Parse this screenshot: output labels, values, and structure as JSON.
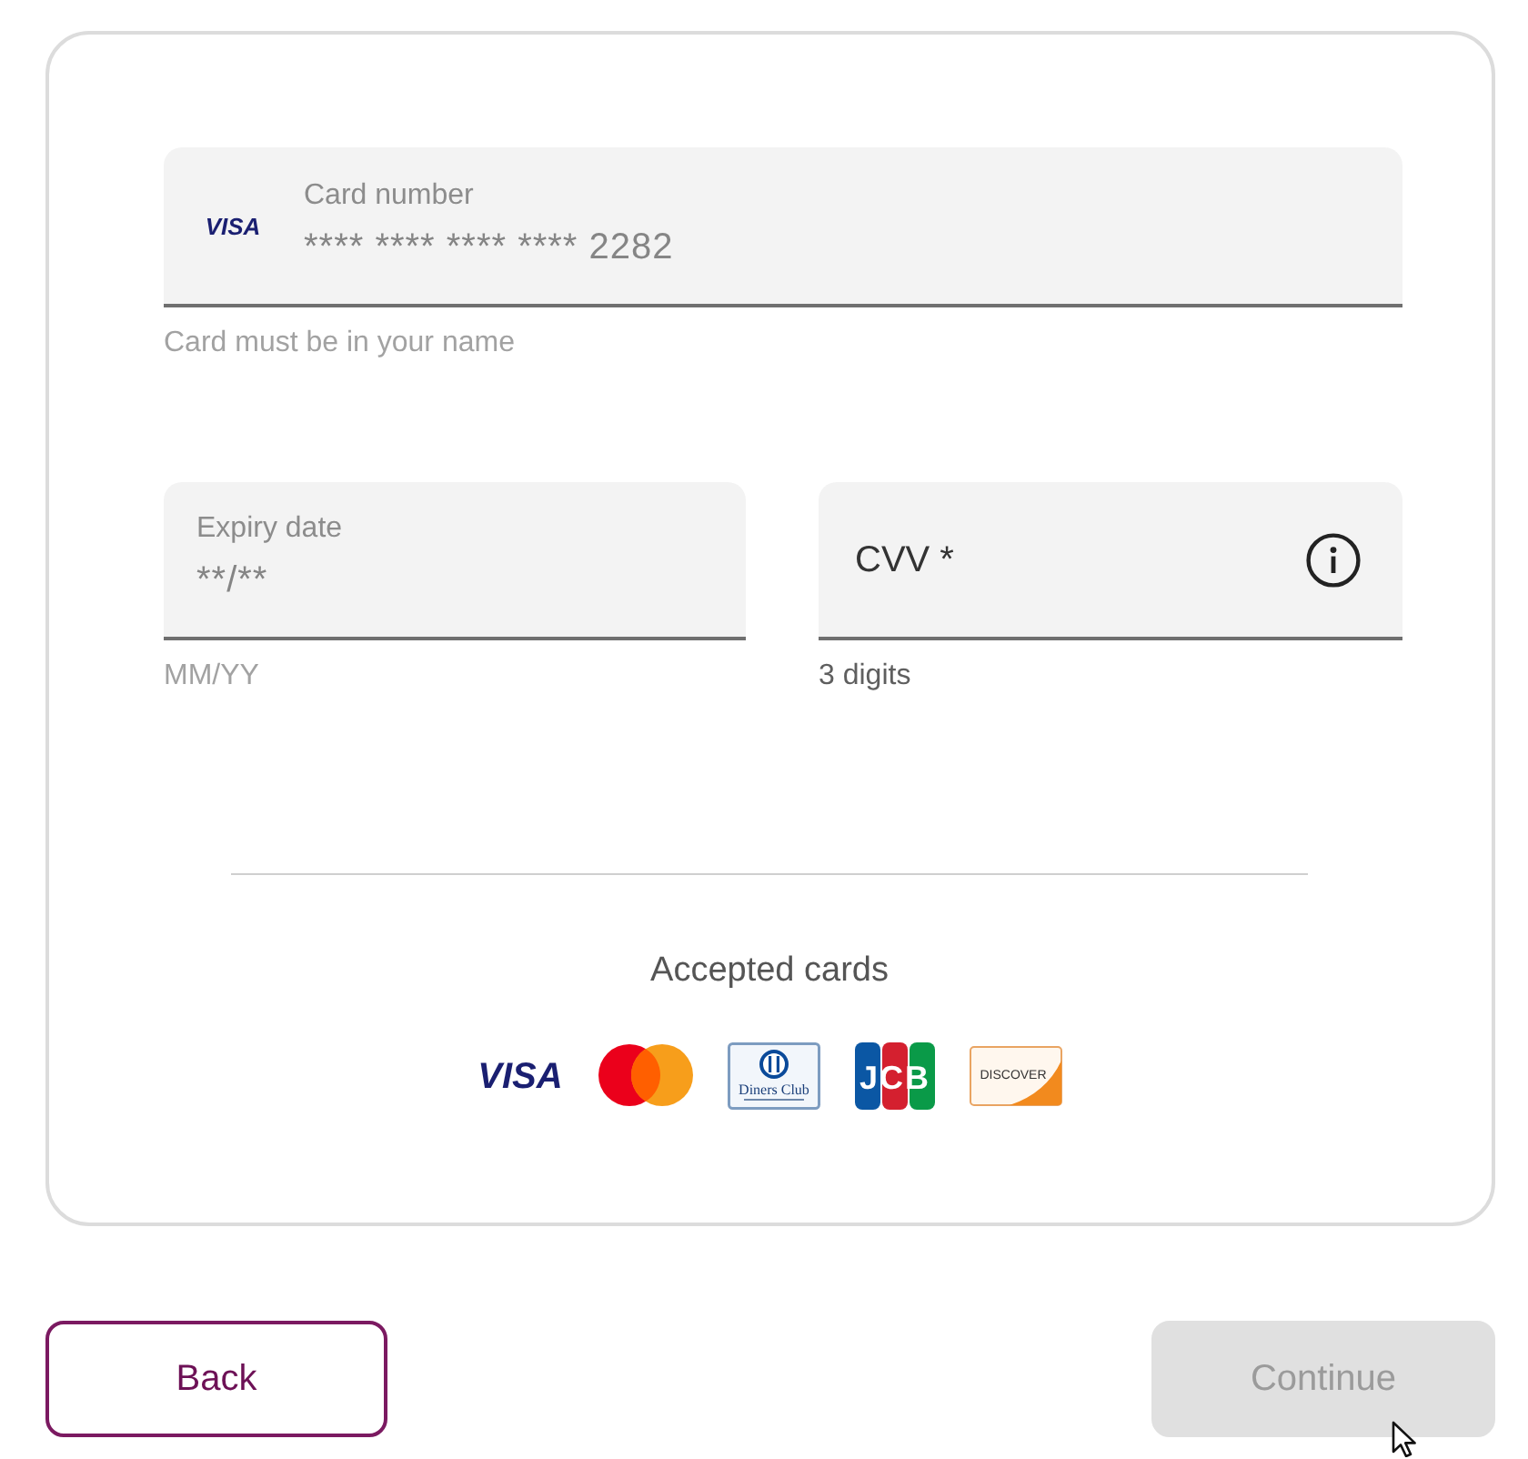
{
  "card_number": {
    "brand": "VISA",
    "label": "Card number",
    "value": "**** **** **** **** 2282",
    "helper": "Card must be in your name",
    "info_button": false
  },
  "date_and_code": [
    {
      "label": "Expiry date",
      "value": "**/**",
      "helper": "MM/YY",
      "info_button": false
    },
    {
      "label": "CVV *",
      "helper": "3 digits",
      "info_button": true
    }
  ],
  "accepted_cards": {
    "title": "Accepted cards",
    "logos": [
      {
        "kind": "visa",
        "text": "VISA"
      },
      {
        "kind": "mastercard"
      },
      {
        "kind": "diners",
        "text": "Diners Club"
      },
      {
        "kind": "jcb",
        "text": "JCB"
      },
      {
        "kind": "discover",
        "text": "DISCOVER"
      }
    ]
  },
  "buttons": [
    {
      "label": "Back",
      "kind": "secondary",
      "disabled": false
    },
    {
      "label": "Continue",
      "kind": "primary",
      "disabled": true
    }
  ]
}
